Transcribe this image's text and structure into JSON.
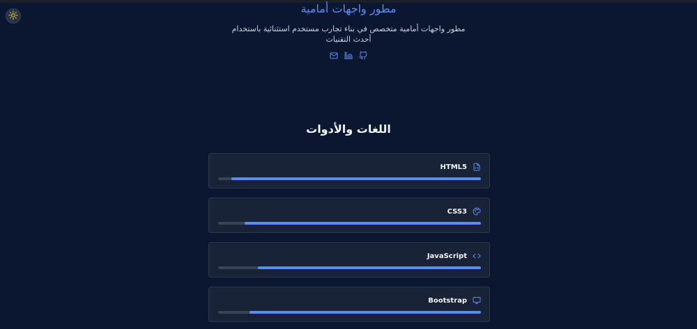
{
  "header": {
    "title": "مطور واجهات أمامية",
    "description": "مطور واجهات أمامية متخصص في بناء تجارب مستخدم استثنائية باستخدام أحدث التقنيات",
    "social": [
      {
        "name": "github-icon"
      },
      {
        "name": "linkedin-icon"
      },
      {
        "name": "mail-icon"
      }
    ]
  },
  "theme_toggle": {
    "icon": "sun-icon"
  },
  "skills_section": {
    "title": "اللغات والأدوات",
    "items": [
      {
        "label": "HTML5",
        "icon": "file-code-icon",
        "level": 95
      },
      {
        "label": "CSS3",
        "icon": "palette-icon",
        "level": 90
      },
      {
        "label": "JavaScript",
        "icon": "code-icon",
        "level": 85
      },
      {
        "label": "Bootstrap",
        "icon": "monitor-icon",
        "level": 88
      }
    ]
  },
  "colors": {
    "background": "#0b1730",
    "accent": "#5b8def",
    "card": "#182338",
    "track": "#3a4458",
    "toggle_icon": "#facc15"
  }
}
